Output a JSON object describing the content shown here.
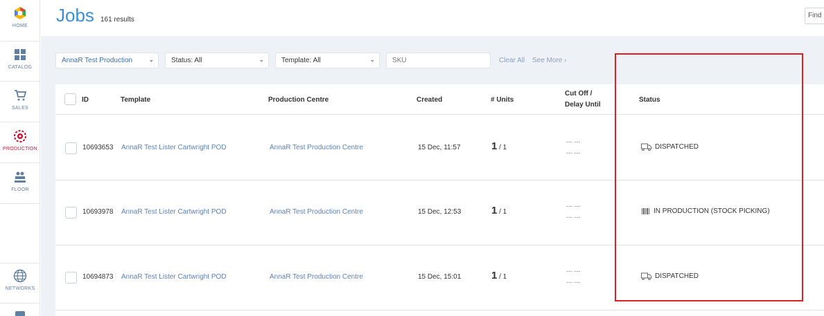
{
  "sidebar": {
    "items": [
      {
        "label": "HOME",
        "icon": "logo-hexagon-icon"
      },
      {
        "label": "CATALOG",
        "icon": "grid-icon"
      },
      {
        "label": "SALES",
        "icon": "cart-icon"
      },
      {
        "label": "PRODUCTION",
        "icon": "gear-icon",
        "active": true
      },
      {
        "label": "FLOOR",
        "icon": "factory-worker-icon"
      },
      {
        "label": "NETWORKS",
        "icon": "globe-icon"
      }
    ],
    "active_color": "#c8102e"
  },
  "header": {
    "title": "Jobs",
    "result_count": "161 results",
    "find_placeholder": "Find"
  },
  "filters": {
    "production_centre": "AnnaR Test Production",
    "status": "Status: All",
    "template": "Template: All",
    "sku_placeholder": "SKU",
    "clear_all": "Clear All",
    "see_more": "See More ›"
  },
  "table": {
    "columns": {
      "id": "ID",
      "template": "Template",
      "production_centre": "Production Centre",
      "created": "Created",
      "units": "# Units",
      "cutoff_line1": "Cut Off /",
      "cutoff_line2": "Delay Until",
      "status": "Status"
    },
    "rows": [
      {
        "id": "10693653",
        "template": "AnnaR Test Lister Cartwright POD",
        "production_centre": "AnnaR Test Production Centre",
        "created": "15 Dec, 11:57",
        "units_done": "1",
        "units_total": "/ 1",
        "cutoff": "--- ---",
        "delay": "--- ---",
        "status": "DISPATCHED",
        "status_icon": "truck-icon"
      },
      {
        "id": "10693978",
        "template": "AnnaR Test Lister Cartwright POD",
        "production_centre": "AnnaR Test Production Centre",
        "created": "15 Dec, 12:53",
        "units_done": "1",
        "units_total": "/ 1",
        "cutoff": "--- ---",
        "delay": "--- ---",
        "status": "IN PRODUCTION (STOCK PICKING)",
        "status_icon": "barcode-icon"
      },
      {
        "id": "10694873",
        "template": "AnnaR Test Lister Cartwright POD",
        "production_centre": "AnnaR Test Production Centre",
        "created": "15 Dec, 15:01",
        "units_done": "1",
        "units_total": "/ 1",
        "cutoff": "--- ---",
        "delay": "--- ---",
        "status": "DISPATCHED",
        "status_icon": "truck-icon"
      }
    ]
  },
  "colors": {
    "title_blue": "#3a8fd9",
    "link_blue": "#5b82b8",
    "highlight_red": "#e02020"
  }
}
